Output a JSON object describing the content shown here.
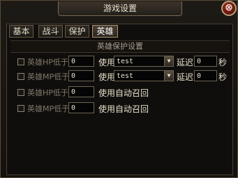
{
  "window": {
    "title": "游戏设置",
    "close_glyph": "⊗"
  },
  "tabs": [
    {
      "label": "基本",
      "active": false
    },
    {
      "label": "战斗",
      "active": false
    },
    {
      "label": "保护",
      "active": false
    },
    {
      "label": "英雄",
      "active": true
    }
  ],
  "section": {
    "title": "英雄保护设置"
  },
  "rows": [
    {
      "label": "英雄HP低于",
      "value": "0",
      "use": "使用",
      "option": "test",
      "delay_label": "延迟",
      "delay_value": "0",
      "unit": "秒"
    },
    {
      "label": "英雄MP低于",
      "value": "0",
      "use": "使用",
      "option": "test",
      "delay_label": "延迟",
      "delay_value": "0",
      "unit": "秒"
    },
    {
      "label": "英雄HP低于",
      "value": "0",
      "action": "使用自动召回"
    },
    {
      "label": "英雄MP低于",
      "value": "0",
      "action": "使用自动召回"
    }
  ],
  "colors": {
    "accent": "#a99272",
    "background": "#14120f"
  }
}
